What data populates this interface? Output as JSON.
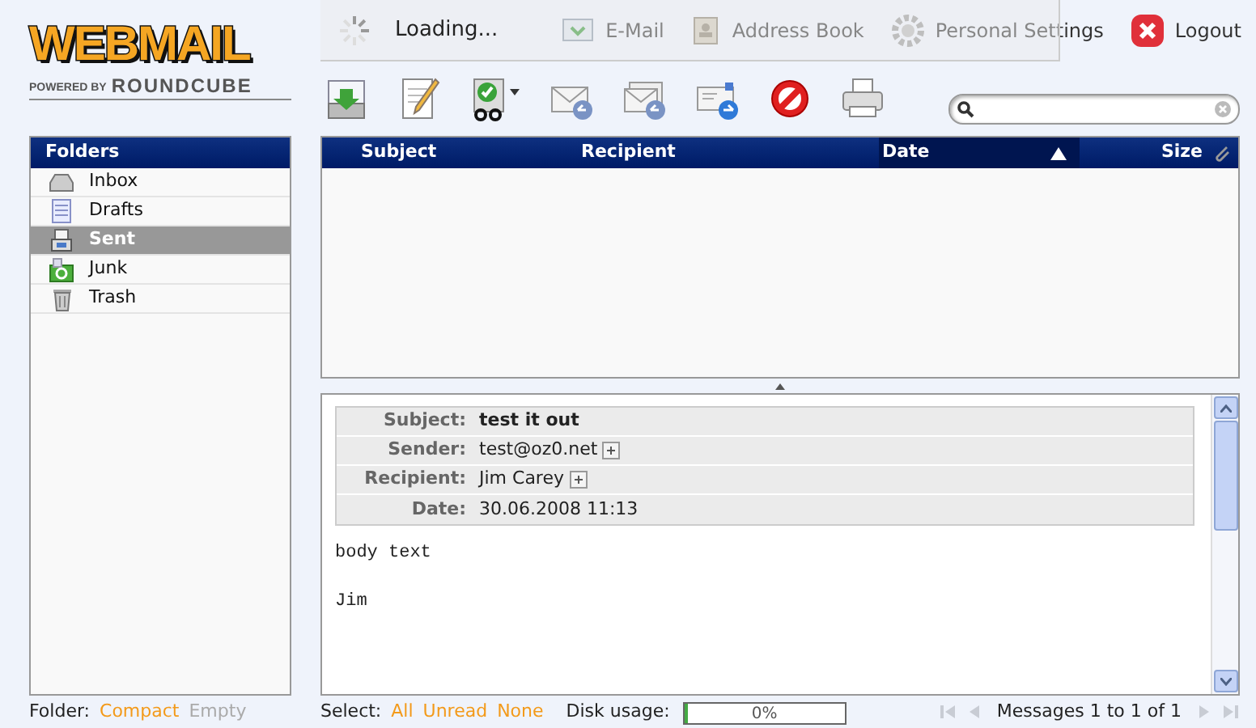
{
  "logo": {
    "title": "WEBMAIL",
    "powered": "POWERED BY",
    "product": "ROUNDCUBE"
  },
  "loading": {
    "text": "Loading..."
  },
  "nav": [
    {
      "label": "E-Mail",
      "kind": "mail"
    },
    {
      "label": "Address Book",
      "kind": "book"
    },
    {
      "label": "Personal Settings",
      "kind": "settings"
    },
    {
      "label": "Logout",
      "kind": "logout"
    }
  ],
  "folders": {
    "title": "Folders",
    "items": [
      {
        "name": "Inbox",
        "kind": "inbox",
        "selected": false
      },
      {
        "name": "Drafts",
        "kind": "drafts",
        "selected": false
      },
      {
        "name": "Sent",
        "kind": "sent",
        "selected": true
      },
      {
        "name": "Junk",
        "kind": "junk",
        "selected": false
      },
      {
        "name": "Trash",
        "kind": "trash",
        "selected": false
      }
    ]
  },
  "message_list": {
    "columns": [
      {
        "label": "Subject",
        "sorted": false
      },
      {
        "label": "Recipient",
        "sorted": false
      },
      {
        "label": "Date",
        "sorted": true
      },
      {
        "label": "Size",
        "sorted": false
      }
    ]
  },
  "preview": {
    "headers": [
      {
        "label": "Subject:",
        "value": "test it out",
        "kind": "subject",
        "expandable": false
      },
      {
        "label": "Sender:",
        "value": "test@oz0.net",
        "kind": "address",
        "expandable": true
      },
      {
        "label": "Recipient:",
        "value": "Jim Carey",
        "kind": "address",
        "expandable": true
      },
      {
        "label": "Date:",
        "value": "30.06.2008 11:13",
        "kind": "date",
        "expandable": false
      }
    ],
    "body": "body text\n\nJim"
  },
  "footer": {
    "folder_label": "Folder:",
    "folder_actions": [
      {
        "label": "Compact",
        "disabled": false
      },
      {
        "label": "Empty",
        "disabled": true
      }
    ],
    "select_label": "Select:",
    "select_actions": [
      {
        "label": "All"
      },
      {
        "label": "Unread"
      },
      {
        "label": "None"
      }
    ],
    "disk_label": "Disk usage:",
    "disk": {
      "level": 0,
      "reading": "0%"
    },
    "pager": {
      "buttons": [
        {
          "kind": "first",
          "disabled": true
        },
        {
          "kind": "prev",
          "disabled": true
        },
        {
          "kind": "next",
          "disabled": true
        },
        {
          "kind": "last",
          "disabled": true
        }
      ],
      "text": "Messages 1 to 1 of 1"
    }
  }
}
